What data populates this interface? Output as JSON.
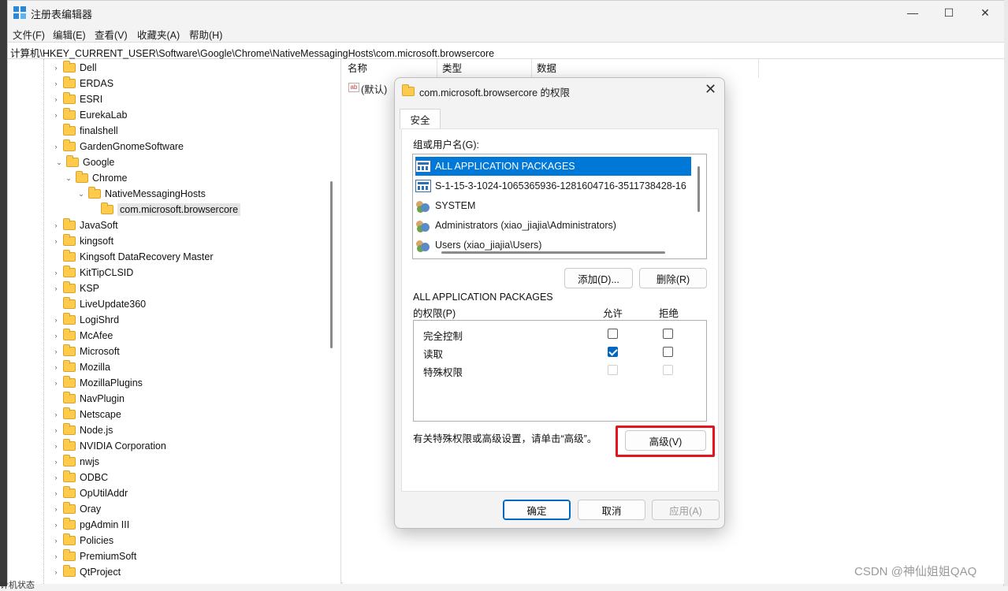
{
  "window": {
    "title": "注册表编辑器",
    "controls": {
      "minimize": "—",
      "maximize": "☐",
      "close": "✕"
    }
  },
  "menu": [
    "文件(F)",
    "编辑(E)",
    "查看(V)",
    "收藏夹(A)",
    "帮助(H)"
  ],
  "address": "计算机\\HKEY_CURRENT_USER\\Software\\Google\\Chrome\\NativeMessagingHosts\\com.microsoft.browsercore",
  "tree": [
    {
      "label": "Dell",
      "chev": "›"
    },
    {
      "label": "ERDAS",
      "chev": "›"
    },
    {
      "label": "ESRI",
      "chev": "›"
    },
    {
      "label": "EurekaLab",
      "chev": "›"
    },
    {
      "label": "finalshell",
      "chev": ""
    },
    {
      "label": "GardenGnomeSoftware",
      "chev": "›"
    },
    {
      "label": "Google",
      "chev": "⌄"
    },
    {
      "label": "Chrome",
      "chev": "⌄"
    },
    {
      "label": "NativeMessagingHosts",
      "chev": "⌄"
    },
    {
      "label": "com.microsoft.browsercore",
      "chev": ""
    },
    {
      "label": "JavaSoft",
      "chev": "›"
    },
    {
      "label": "kingsoft",
      "chev": "›"
    },
    {
      "label": "Kingsoft DataRecovery Master",
      "chev": ""
    },
    {
      "label": "KitTipCLSID",
      "chev": "›"
    },
    {
      "label": "KSP",
      "chev": "›"
    },
    {
      "label": "LiveUpdate360",
      "chev": ""
    },
    {
      "label": "LogiShrd",
      "chev": "›"
    },
    {
      "label": "McAfee",
      "chev": "›"
    },
    {
      "label": "Microsoft",
      "chev": "›"
    },
    {
      "label": "Mozilla",
      "chev": "›"
    },
    {
      "label": "MozillaPlugins",
      "chev": "›"
    },
    {
      "label": "NavPlugin",
      "chev": ""
    },
    {
      "label": "Netscape",
      "chev": "›"
    },
    {
      "label": "Node.js",
      "chev": "›"
    },
    {
      "label": "NVIDIA Corporation",
      "chev": "›"
    },
    {
      "label": "nwjs",
      "chev": "›"
    },
    {
      "label": "ODBC",
      "chev": "›"
    },
    {
      "label": "OpUtilAddr",
      "chev": "›"
    },
    {
      "label": "Oray",
      "chev": "›"
    },
    {
      "label": "pgAdmin III",
      "chev": "›"
    },
    {
      "label": "Policies",
      "chev": "›"
    },
    {
      "label": "PremiumSoft",
      "chev": "›"
    },
    {
      "label": "QtProject",
      "chev": "›"
    }
  ],
  "list": {
    "columns": [
      "名称",
      "类型",
      "数据"
    ],
    "rows": [
      {
        "name": "(默认)",
        "icon": "ab"
      }
    ]
  },
  "dialog": {
    "title": "com.microsoft.browsercore 的权限",
    "close": "✕",
    "tab": "安全",
    "group_label": "组或用户名(G):",
    "users": [
      {
        "name": "ALL APPLICATION PACKAGES",
        "icon": "package",
        "selected": true
      },
      {
        "name": "S-1-15-3-1024-1065365936-1281604716-3511738428-16",
        "icon": "package",
        "selected": false
      },
      {
        "name": "SYSTEM",
        "icon": "group",
        "selected": false
      },
      {
        "name": "Administrators (xiao_jiajia\\Administrators)",
        "icon": "group",
        "selected": false
      },
      {
        "name": "Users (xiao_jiajia\\Users)",
        "icon": "group",
        "selected": false
      }
    ],
    "add_button": "添加(D)...",
    "remove_button": "删除(R)",
    "perm_for_line1": "ALL APPLICATION PACKAGES",
    "perm_for_line2": "的权限(P)",
    "allow_header": "允许",
    "deny_header": "拒绝",
    "permissions": [
      {
        "name": "完全控制",
        "allow": false,
        "deny": false,
        "enabled": true
      },
      {
        "name": "读取",
        "allow": true,
        "deny": false,
        "enabled": true
      },
      {
        "name": "特殊权限",
        "allow": false,
        "deny": false,
        "enabled": false
      }
    ],
    "advanced_hint": "有关特殊权限或高级设置，请单击“高级”。",
    "advanced_button": "高级(V)",
    "ok_button": "确定",
    "cancel_button": "取消",
    "apply_button": "应用(A)",
    "highlight_color": "#e5141b"
  },
  "watermark": "CSDN @神仙姐姐QAQ",
  "status_fragment": "计机状态"
}
